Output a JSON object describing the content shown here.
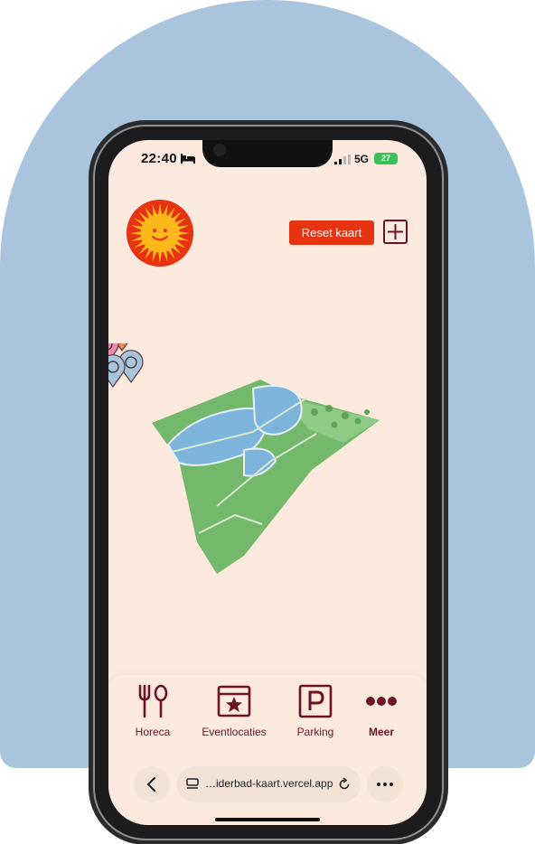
{
  "status_bar": {
    "time": "22:40",
    "network": "5G",
    "battery": "27"
  },
  "header": {
    "logo": "sun-face-logo",
    "reset_label": "Reset kaart",
    "add_icon": "plus-icon"
  },
  "map": {
    "pin_icons": [
      "paw-icon",
      "bicycle-icon",
      "yoga-icon",
      "parking-icon",
      "toilet-icon",
      "cash-icon",
      "entrance-icon",
      "star-icon",
      "food-icon"
    ]
  },
  "tabbar": {
    "items": [
      {
        "label": "Horeca",
        "icon": "fork-knife-icon"
      },
      {
        "label": "Eventlocaties",
        "icon": "calendar-star-icon"
      },
      {
        "label": "Parking",
        "icon": "parking-icon"
      },
      {
        "label": "Meer",
        "icon": "more-dots-icon"
      }
    ]
  },
  "browser": {
    "url": "…iderbad-kaart.vercel.app"
  },
  "colors": {
    "accent": "#e63312",
    "brand_dark": "#6b1226",
    "screen_bg": "#fdeadf",
    "backdrop": "#a9c4dd",
    "park_green": "#74b86c",
    "water": "#7db4dc"
  }
}
